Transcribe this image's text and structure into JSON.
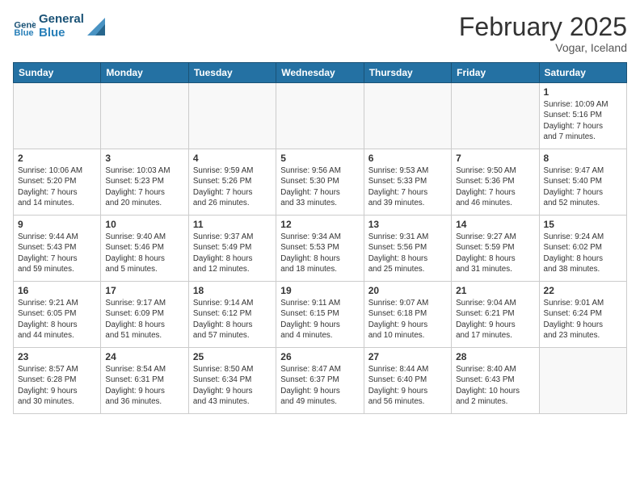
{
  "header": {
    "logo_line1": "General",
    "logo_line2": "Blue",
    "month": "February 2025",
    "location": "Vogar, Iceland"
  },
  "days_of_week": [
    "Sunday",
    "Monday",
    "Tuesday",
    "Wednesday",
    "Thursday",
    "Friday",
    "Saturday"
  ],
  "weeks": [
    [
      {
        "day": "",
        "info": ""
      },
      {
        "day": "",
        "info": ""
      },
      {
        "day": "",
        "info": ""
      },
      {
        "day": "",
        "info": ""
      },
      {
        "day": "",
        "info": ""
      },
      {
        "day": "",
        "info": ""
      },
      {
        "day": "1",
        "info": "Sunrise: 10:09 AM\nSunset: 5:16 PM\nDaylight: 7 hours\nand 7 minutes."
      }
    ],
    [
      {
        "day": "2",
        "info": "Sunrise: 10:06 AM\nSunset: 5:20 PM\nDaylight: 7 hours\nand 14 minutes."
      },
      {
        "day": "3",
        "info": "Sunrise: 10:03 AM\nSunset: 5:23 PM\nDaylight: 7 hours\nand 20 minutes."
      },
      {
        "day": "4",
        "info": "Sunrise: 9:59 AM\nSunset: 5:26 PM\nDaylight: 7 hours\nand 26 minutes."
      },
      {
        "day": "5",
        "info": "Sunrise: 9:56 AM\nSunset: 5:30 PM\nDaylight: 7 hours\nand 33 minutes."
      },
      {
        "day": "6",
        "info": "Sunrise: 9:53 AM\nSunset: 5:33 PM\nDaylight: 7 hours\nand 39 minutes."
      },
      {
        "day": "7",
        "info": "Sunrise: 9:50 AM\nSunset: 5:36 PM\nDaylight: 7 hours\nand 46 minutes."
      },
      {
        "day": "8",
        "info": "Sunrise: 9:47 AM\nSunset: 5:40 PM\nDaylight: 7 hours\nand 52 minutes."
      }
    ],
    [
      {
        "day": "9",
        "info": "Sunrise: 9:44 AM\nSunset: 5:43 PM\nDaylight: 7 hours\nand 59 minutes."
      },
      {
        "day": "10",
        "info": "Sunrise: 9:40 AM\nSunset: 5:46 PM\nDaylight: 8 hours\nand 5 minutes."
      },
      {
        "day": "11",
        "info": "Sunrise: 9:37 AM\nSunset: 5:49 PM\nDaylight: 8 hours\nand 12 minutes."
      },
      {
        "day": "12",
        "info": "Sunrise: 9:34 AM\nSunset: 5:53 PM\nDaylight: 8 hours\nand 18 minutes."
      },
      {
        "day": "13",
        "info": "Sunrise: 9:31 AM\nSunset: 5:56 PM\nDaylight: 8 hours\nand 25 minutes."
      },
      {
        "day": "14",
        "info": "Sunrise: 9:27 AM\nSunset: 5:59 PM\nDaylight: 8 hours\nand 31 minutes."
      },
      {
        "day": "15",
        "info": "Sunrise: 9:24 AM\nSunset: 6:02 PM\nDaylight: 8 hours\nand 38 minutes."
      }
    ],
    [
      {
        "day": "16",
        "info": "Sunrise: 9:21 AM\nSunset: 6:05 PM\nDaylight: 8 hours\nand 44 minutes."
      },
      {
        "day": "17",
        "info": "Sunrise: 9:17 AM\nSunset: 6:09 PM\nDaylight: 8 hours\nand 51 minutes."
      },
      {
        "day": "18",
        "info": "Sunrise: 9:14 AM\nSunset: 6:12 PM\nDaylight: 8 hours\nand 57 minutes."
      },
      {
        "day": "19",
        "info": "Sunrise: 9:11 AM\nSunset: 6:15 PM\nDaylight: 9 hours\nand 4 minutes."
      },
      {
        "day": "20",
        "info": "Sunrise: 9:07 AM\nSunset: 6:18 PM\nDaylight: 9 hours\nand 10 minutes."
      },
      {
        "day": "21",
        "info": "Sunrise: 9:04 AM\nSunset: 6:21 PM\nDaylight: 9 hours\nand 17 minutes."
      },
      {
        "day": "22",
        "info": "Sunrise: 9:01 AM\nSunset: 6:24 PM\nDaylight: 9 hours\nand 23 minutes."
      }
    ],
    [
      {
        "day": "23",
        "info": "Sunrise: 8:57 AM\nSunset: 6:28 PM\nDaylight: 9 hours\nand 30 minutes."
      },
      {
        "day": "24",
        "info": "Sunrise: 8:54 AM\nSunset: 6:31 PM\nDaylight: 9 hours\nand 36 minutes."
      },
      {
        "day": "25",
        "info": "Sunrise: 8:50 AM\nSunset: 6:34 PM\nDaylight: 9 hours\nand 43 minutes."
      },
      {
        "day": "26",
        "info": "Sunrise: 8:47 AM\nSunset: 6:37 PM\nDaylight: 9 hours\nand 49 minutes."
      },
      {
        "day": "27",
        "info": "Sunrise: 8:44 AM\nSunset: 6:40 PM\nDaylight: 9 hours\nand 56 minutes."
      },
      {
        "day": "28",
        "info": "Sunrise: 8:40 AM\nSunset: 6:43 PM\nDaylight: 10 hours\nand 2 minutes."
      },
      {
        "day": "",
        "info": ""
      }
    ]
  ]
}
